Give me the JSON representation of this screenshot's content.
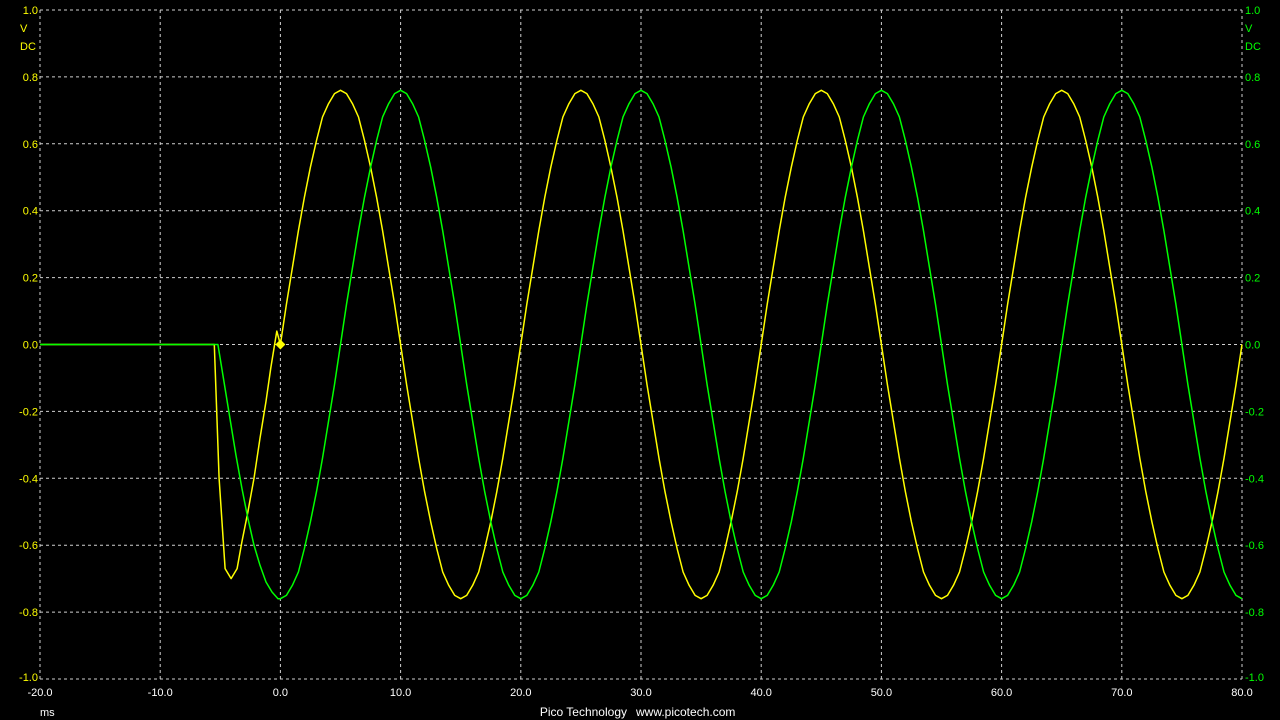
{
  "chart_data": {
    "type": "line",
    "title": "",
    "xlabel": "ms",
    "xlim": [
      -20,
      80
    ],
    "ylim": [
      -1.0,
      1.0
    ],
    "grid": true,
    "x_ticks": [
      "-20.0",
      "-10.0",
      "0.0",
      "10.0",
      "20.0",
      "30.0",
      "40.0",
      "50.0",
      "60.0",
      "70.0",
      "80.0"
    ],
    "y_ticks": [
      "1.0",
      "0.8",
      "0.6",
      "0.4",
      "0.2",
      "0.0",
      "-0.2",
      "-0.4",
      "-0.6",
      "-0.8",
      "-1.0"
    ],
    "left_axis": {
      "unit": "V",
      "coupling": "DC",
      "color": "#ffff00"
    },
    "right_axis": {
      "unit": "V",
      "coupling": "DC",
      "color": "#00ff00"
    },
    "trigger": {
      "x": 0.0,
      "y": 0.0,
      "color": "#ffff00"
    },
    "series": [
      {
        "color": "#ffff00",
        "axis": "left",
        "x": [
          -20,
          -5.5,
          -5.1,
          -4.6,
          -4.1,
          -3.6,
          -3.2,
          -2.7,
          -2.2,
          -1.7,
          -1.2,
          -0.8,
          -0.3,
          0,
          0.5,
          1,
          1.5,
          2,
          2.5,
          3,
          3.5,
          4,
          4.5,
          5,
          5.5,
          6,
          6.5,
          7,
          7.5,
          8,
          8.5,
          9,
          9.5,
          10,
          10.5,
          11,
          11.5,
          12,
          12.5,
          13,
          13.5,
          14,
          14.5,
          15,
          15.5,
          16,
          16.5,
          17,
          17.5,
          18,
          18.5,
          19,
          19.5,
          20,
          20.5,
          21,
          21.5,
          22,
          22.5,
          23,
          23.5,
          24,
          24.5,
          25,
          25.5,
          26,
          26.5,
          27,
          27.5,
          28,
          28.5,
          29,
          29.5,
          30,
          30.5,
          31,
          31.5,
          32,
          32.5,
          33,
          33.5,
          34,
          34.5,
          35,
          35.5,
          36,
          36.5,
          37,
          37.5,
          38,
          38.5,
          39,
          39.5,
          40,
          40.5,
          41,
          41.5,
          42,
          42.5,
          43,
          43.5,
          44,
          44.5,
          45,
          45.5,
          46,
          46.5,
          47,
          47.5,
          48,
          48.5,
          49,
          49.5,
          50,
          50.5,
          51,
          51.5,
          52,
          52.5,
          53,
          53.5,
          54,
          54.5,
          55,
          55.5,
          56,
          56.5,
          57,
          57.5,
          58,
          58.5,
          59,
          59.5,
          60,
          60.5,
          61,
          61.5,
          62,
          62.5,
          63,
          63.5,
          64,
          64.5,
          65,
          65.5,
          66,
          66.5,
          67,
          67.5,
          68,
          68.5,
          69,
          69.5,
          70,
          70.5,
          71,
          71.5,
          72,
          72.5,
          73,
          73.5,
          74,
          74.5,
          75,
          75.5,
          76,
          76.5,
          77,
          77.5,
          78,
          78.5,
          79,
          79.5,
          80
        ],
        "values": [
          0,
          0,
          -0.4,
          -0.67,
          -0.7,
          -0.67,
          -0.59,
          -0.5,
          -0.4,
          -0.28,
          -0.17,
          -0.07,
          0.04,
          0,
          0.12,
          0.23,
          0.34,
          0.44,
          0.53,
          0.61,
          0.68,
          0.72,
          0.75,
          0.76,
          0.75,
          0.72,
          0.68,
          0.61,
          0.53,
          0.44,
          0.34,
          0.23,
          0.12,
          0,
          -0.12,
          -0.23,
          -0.34,
          -0.44,
          -0.53,
          -0.61,
          -0.68,
          -0.72,
          -0.75,
          -0.76,
          -0.75,
          -0.72,
          -0.68,
          -0.61,
          -0.53,
          -0.44,
          -0.34,
          -0.23,
          -0.12,
          0,
          0.12,
          0.23,
          0.34,
          0.44,
          0.53,
          0.61,
          0.68,
          0.72,
          0.75,
          0.76,
          0.75,
          0.72,
          0.68,
          0.61,
          0.53,
          0.44,
          0.34,
          0.23,
          0.12,
          0,
          -0.12,
          -0.23,
          -0.34,
          -0.44,
          -0.53,
          -0.61,
          -0.68,
          -0.72,
          -0.75,
          -0.76,
          -0.75,
          -0.72,
          -0.68,
          -0.61,
          -0.53,
          -0.44,
          -0.34,
          -0.23,
          -0.12,
          0,
          0.12,
          0.23,
          0.34,
          0.44,
          0.53,
          0.61,
          0.68,
          0.72,
          0.75,
          0.76,
          0.75,
          0.72,
          0.68,
          0.61,
          0.53,
          0.44,
          0.34,
          0.23,
          0.12,
          0,
          -0.12,
          -0.23,
          -0.34,
          -0.44,
          -0.53,
          -0.61,
          -0.68,
          -0.72,
          -0.75,
          -0.76,
          -0.75,
          -0.72,
          -0.68,
          -0.61,
          -0.53,
          -0.44,
          -0.34,
          -0.23,
          -0.12,
          0,
          0.12,
          0.23,
          0.34,
          0.44,
          0.53,
          0.61,
          0.68,
          0.72,
          0.75,
          0.76,
          0.75,
          0.72,
          0.68,
          0.61,
          0.53,
          0.44,
          0.34,
          0.23,
          0.12,
          0,
          -0.12,
          -0.23,
          -0.34,
          -0.44,
          -0.53,
          -0.61,
          -0.68,
          -0.72,
          -0.75,
          -0.76,
          -0.75,
          -0.72,
          -0.68,
          -0.61,
          -0.53,
          -0.44,
          -0.34,
          -0.23,
          -0.12,
          0
        ]
      },
      {
        "color": "#00ff00",
        "axis": "right",
        "x": [
          -20,
          -5.2,
          -4.7,
          -4.2,
          -3.7,
          -3.2,
          -2.7,
          -2.2,
          -1.7,
          -1.2,
          -0.7,
          -0.2,
          0,
          0.5,
          1,
          1.5,
          2,
          2.5,
          3,
          3.5,
          4,
          4.5,
          5,
          5.5,
          6,
          6.5,
          7,
          7.5,
          8,
          8.5,
          9,
          9.5,
          10,
          10.5,
          11,
          11.5,
          12,
          12.5,
          13,
          13.5,
          14,
          14.5,
          15,
          15.5,
          16,
          16.5,
          17,
          17.5,
          18,
          18.5,
          19,
          19.5,
          20,
          20.5,
          21,
          21.5,
          22,
          22.5,
          23,
          23.5,
          24,
          24.5,
          25,
          25.5,
          26,
          26.5,
          27,
          27.5,
          28,
          28.5,
          29,
          29.5,
          30,
          30.5,
          31,
          31.5,
          32,
          32.5,
          33,
          33.5,
          34,
          34.5,
          35,
          35.5,
          36,
          36.5,
          37,
          37.5,
          38,
          38.5,
          39,
          39.5,
          40,
          40.5,
          41,
          41.5,
          42,
          42.5,
          43,
          43.5,
          44,
          44.5,
          45,
          45.5,
          46,
          46.5,
          47,
          47.5,
          48,
          48.5,
          49,
          49.5,
          50,
          50.5,
          51,
          51.5,
          52,
          52.5,
          53,
          53.5,
          54,
          54.5,
          55,
          55.5,
          56,
          56.5,
          57,
          57.5,
          58,
          58.5,
          59,
          59.5,
          60,
          60.5,
          61,
          61.5,
          62,
          62.5,
          63,
          63.5,
          64,
          64.5,
          65,
          65.5,
          66,
          66.5,
          67,
          67.5,
          68,
          68.5,
          69,
          69.5,
          70,
          70.5,
          71,
          71.5,
          72,
          72.5,
          73,
          73.5,
          74,
          74.5,
          75,
          75.5,
          76,
          76.5,
          77,
          77.5,
          78,
          78.5,
          79,
          79.5,
          80
        ],
        "values": [
          0,
          0,
          -0.11,
          -0.22,
          -0.33,
          -0.43,
          -0.52,
          -0.6,
          -0.66,
          -0.71,
          -0.74,
          -0.76,
          -0.76,
          -0.75,
          -0.72,
          -0.68,
          -0.61,
          -0.53,
          -0.44,
          -0.34,
          -0.23,
          -0.12,
          0,
          0.12,
          0.23,
          0.34,
          0.44,
          0.53,
          0.61,
          0.68,
          0.72,
          0.75,
          0.76,
          0.75,
          0.72,
          0.68,
          0.61,
          0.53,
          0.44,
          0.34,
          0.23,
          0.12,
          0,
          -0.12,
          -0.23,
          -0.34,
          -0.44,
          -0.53,
          -0.61,
          -0.68,
          -0.72,
          -0.75,
          -0.76,
          -0.75,
          -0.72,
          -0.68,
          -0.61,
          -0.53,
          -0.44,
          -0.34,
          -0.23,
          -0.12,
          0,
          0.12,
          0.23,
          0.34,
          0.44,
          0.53,
          0.61,
          0.68,
          0.72,
          0.75,
          0.76,
          0.75,
          0.72,
          0.68,
          0.61,
          0.53,
          0.44,
          0.34,
          0.23,
          0.12,
          0,
          -0.12,
          -0.23,
          -0.34,
          -0.44,
          -0.53,
          -0.61,
          -0.68,
          -0.72,
          -0.75,
          -0.76,
          -0.75,
          -0.72,
          -0.68,
          -0.61,
          -0.53,
          -0.44,
          -0.34,
          -0.23,
          -0.12,
          0,
          0.12,
          0.23,
          0.34,
          0.44,
          0.53,
          0.61,
          0.68,
          0.72,
          0.75,
          0.76,
          0.75,
          0.72,
          0.68,
          0.61,
          0.53,
          0.44,
          0.34,
          0.23,
          0.12,
          0,
          -0.12,
          -0.23,
          -0.34,
          -0.44,
          -0.53,
          -0.61,
          -0.68,
          -0.72,
          -0.75,
          -0.76,
          -0.75,
          -0.72,
          -0.68,
          -0.61,
          -0.53,
          -0.44,
          -0.34,
          -0.23,
          -0.12,
          0,
          0.12,
          0.23,
          0.34,
          0.44,
          0.53,
          0.61,
          0.68,
          0.72,
          0.75,
          0.76,
          0.75,
          0.72,
          0.68,
          0.61,
          0.53,
          0.44,
          0.34,
          0.23,
          0.12,
          0,
          -0.12,
          -0.23,
          -0.34,
          -0.44,
          -0.53,
          -0.61,
          -0.68,
          -0.72,
          -0.75,
          -0.76
        ]
      }
    ]
  },
  "footer": {
    "brand": "Pico Technology",
    "url": "www.picotech.com"
  }
}
